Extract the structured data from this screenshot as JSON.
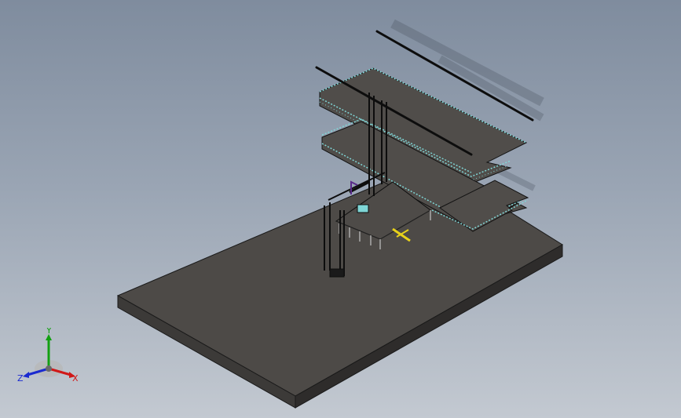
{
  "viewport": {
    "background_top": "#7f8c9e",
    "background_bottom": "#c3c9d1"
  },
  "triad": {
    "x_label": "X",
    "y_label": "Y",
    "z_label": "Z",
    "x_color": "#d01818",
    "y_color": "#12a012",
    "z_color": "#1a2ad0"
  },
  "model": {
    "base_plate_color": "#4d4a47",
    "shelf_color": "#504d4a",
    "railing_color": "#7fd6d6",
    "frame_color": "#0d0d0d",
    "marker_color": "#e8d21a"
  }
}
